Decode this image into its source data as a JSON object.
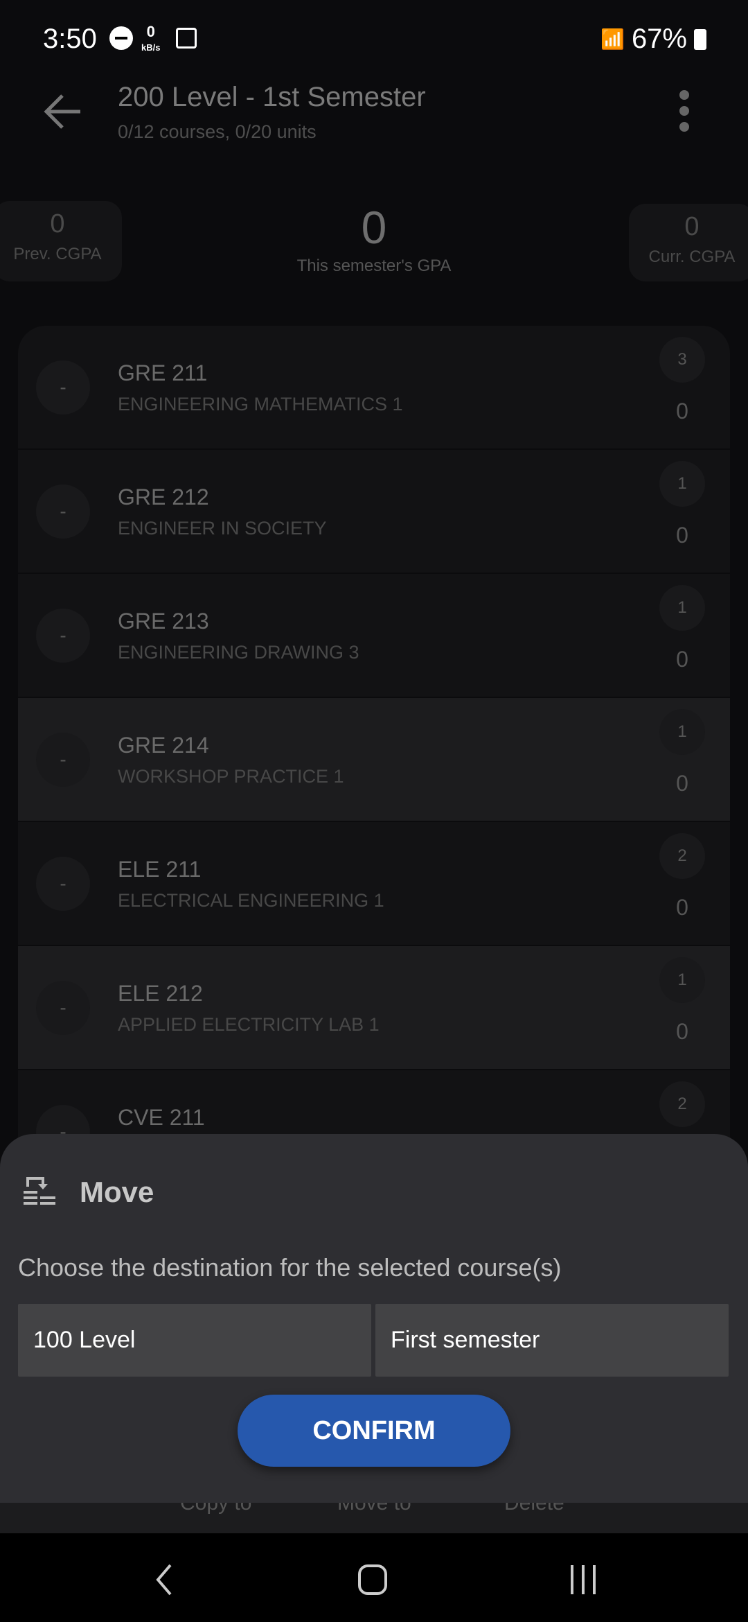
{
  "status_bar": {
    "time": "3:50",
    "net_speed": "0",
    "net_unit": "kB/s",
    "battery": "67%"
  },
  "header": {
    "title": "200 Level - 1st Semester",
    "subtitle": "0/12 courses, 0/20 units"
  },
  "stats": {
    "prev_cgpa": {
      "value": "0",
      "label": "Prev. CGPA"
    },
    "semester_gpa": {
      "value": "0",
      "label": "This semester's GPA"
    },
    "curr_cgpa": {
      "value": "0",
      "label": "Curr. CGPA"
    }
  },
  "courses": [
    {
      "grade_badge": "-",
      "code": "GRE 211",
      "name": "ENGINEERING MATHEMATICS 1",
      "units": "3",
      "score": "0",
      "selected": false
    },
    {
      "grade_badge": "-",
      "code": "GRE 212",
      "name": "ENGINEER IN SOCIETY",
      "units": "1",
      "score": "0",
      "selected": false
    },
    {
      "grade_badge": "-",
      "code": "GRE 213",
      "name": "ENGINEERING DRAWING 3",
      "units": "1",
      "score": "0",
      "selected": false
    },
    {
      "grade_badge": "-",
      "code": "GRE 214",
      "name": "WORKSHOP PRACTICE 1",
      "units": "1",
      "score": "0",
      "selected": true
    },
    {
      "grade_badge": "-",
      "code": "ELE 211",
      "name": "ELECTRICAL ENGINEERING 1",
      "units": "2",
      "score": "0",
      "selected": false
    },
    {
      "grade_badge": "-",
      "code": "ELE 212",
      "name": "APPLIED ELECTRICITY LAB 1",
      "units": "1",
      "score": "0",
      "selected": true
    },
    {
      "grade_badge": "-",
      "code": "CVE 211",
      "name": "",
      "units": "2",
      "score": "",
      "selected": false
    }
  ],
  "action_bar": {
    "copy": "Copy to",
    "move": "Move to",
    "delete": "Delete"
  },
  "sheet": {
    "title": "Move",
    "icon": "move-icon",
    "description": "Choose the destination for the selected course(s)",
    "level_value": "100 Level",
    "semester_value": "First semester",
    "confirm": "CONFIRM"
  },
  "colors": {
    "accent": "#2658ad",
    "sheet_bg": "#2e2e32",
    "field_bg": "#434345"
  }
}
